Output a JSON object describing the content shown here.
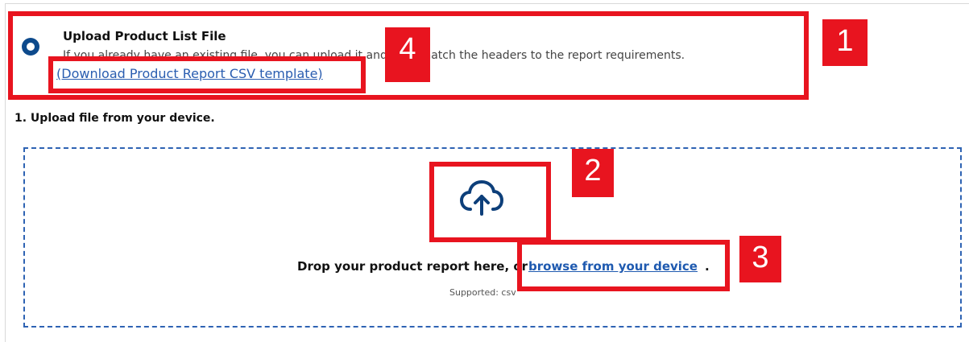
{
  "option": {
    "title": "Upload Product List File",
    "description": "If you already have an existing file, you can upload it and then match the headers to the report requirements.",
    "template_link": "(Download Product Report CSV template)"
  },
  "step1": {
    "heading": "1. Upload file from your device."
  },
  "dropzone": {
    "icon": "cloud-upload-icon",
    "prompt": "Drop your product report here, or",
    "browse_link": "browse from your device",
    "period": ".",
    "supported": "Supported: csv"
  },
  "annotations": {
    "badge1": "1",
    "badge2": "2",
    "badge3": "3",
    "badge4": "4",
    "color": "#e8141f"
  },
  "colors": {
    "accent": "#0d4a8c",
    "link": "#2a5db0",
    "dashed_border": "#2e63b3"
  }
}
